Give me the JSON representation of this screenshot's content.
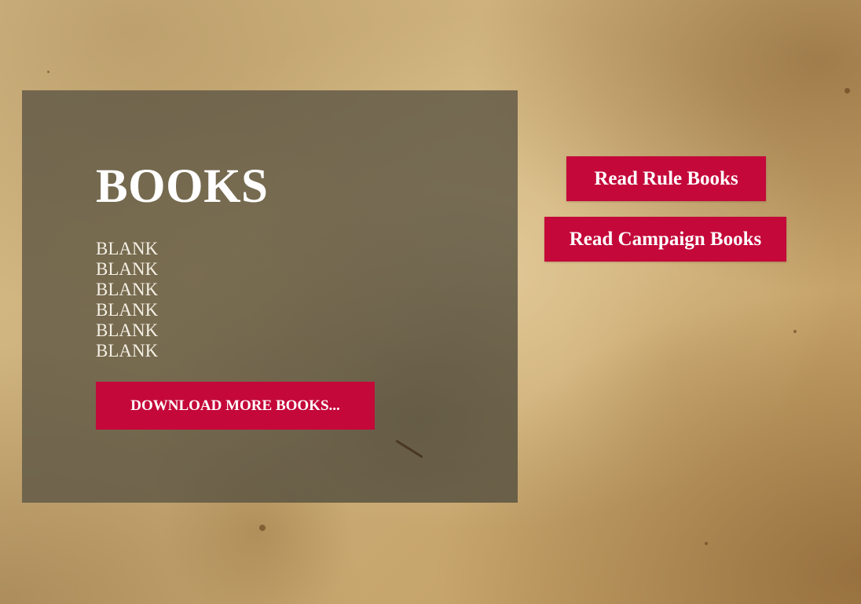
{
  "books_panel": {
    "title": "BOOKS",
    "items": [
      "BLANK",
      "BLANK",
      "BLANK",
      "BLANK",
      "BLANK",
      "BLANK"
    ],
    "download_button_label": "DOWNLOAD MORE BOOKS..."
  },
  "actions": {
    "rule_books_label": "Read Rule Books",
    "campaign_books_label": "Read Campaign Books"
  },
  "colors": {
    "button_red": "#c4083a",
    "panel_overlay": "#5f5846",
    "parchment": "#c9ab74",
    "text_white": "#ffffff"
  }
}
